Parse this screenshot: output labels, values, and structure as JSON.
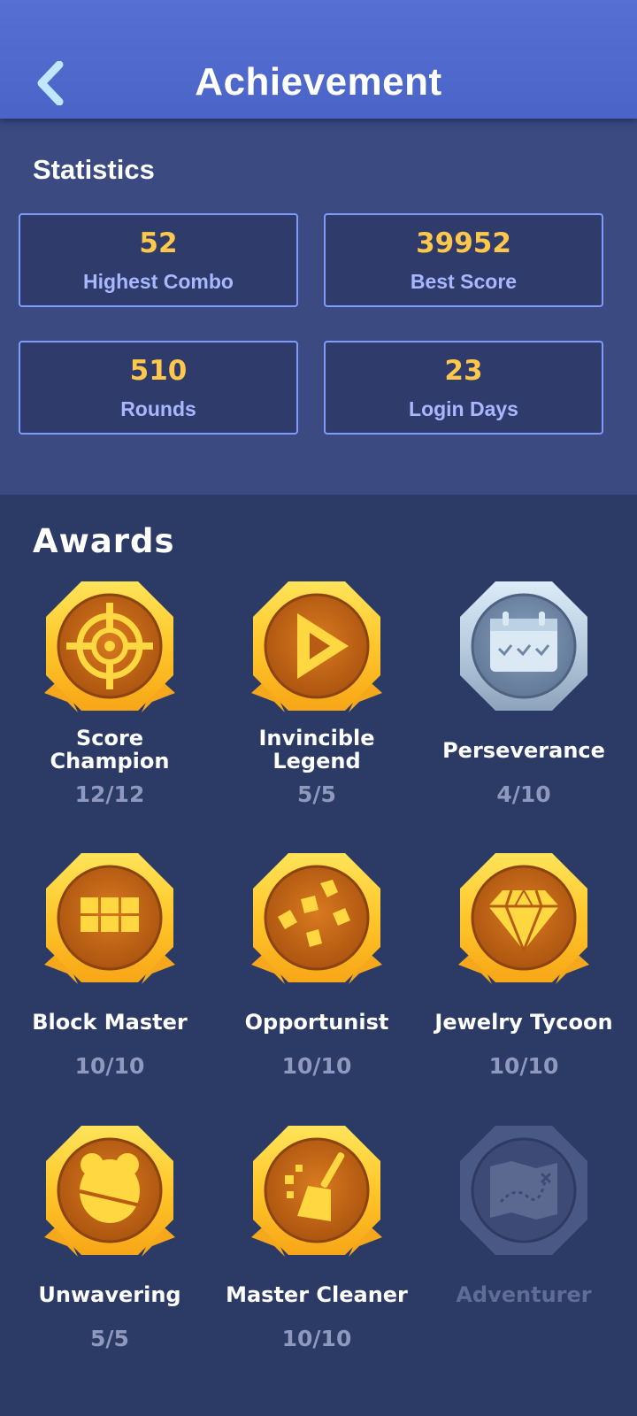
{
  "header": {
    "title": "Achievement"
  },
  "statistics": {
    "title": "Statistics",
    "cards": [
      {
        "value": "52",
        "label": "Highest Combo"
      },
      {
        "value": "39952",
        "label": "Best Score"
      },
      {
        "value": "510",
        "label": "Rounds"
      },
      {
        "value": "23",
        "label": "Login Days"
      }
    ]
  },
  "awards": {
    "title": "Awards",
    "items": [
      {
        "name": "Score Champion",
        "count": "12/12",
        "icon": "target-icon",
        "state": "gold"
      },
      {
        "name": "Invincible Legend",
        "count": "5/5",
        "icon": "play-icon",
        "state": "gold"
      },
      {
        "name": "Perseverance",
        "count": "4/10",
        "icon": "calendar-icon",
        "state": "silver"
      },
      {
        "name": "Block Master",
        "count": "10/10",
        "icon": "blocks-icon",
        "state": "gold"
      },
      {
        "name": "Opportunist",
        "count": "10/10",
        "icon": "gems-icon",
        "state": "gold"
      },
      {
        "name": "Jewelry Tycoon",
        "count": "10/10",
        "icon": "diamond-icon",
        "state": "gold"
      },
      {
        "name": "Unwavering",
        "count": "5/5",
        "icon": "bear-icon",
        "state": "gold"
      },
      {
        "name": "Master Cleaner",
        "count": "10/10",
        "icon": "broom-icon",
        "state": "gold"
      },
      {
        "name": "Adventurer",
        "count": "",
        "icon": "map-icon",
        "state": "locked"
      }
    ]
  },
  "colors": {
    "header": "#566fd3",
    "stat_value": "#ffc84a",
    "stat_label": "#a9b7ff",
    "card_border": "#7f9bff",
    "gold": "#ffcf2e",
    "medal_inner": "#c2691a"
  }
}
